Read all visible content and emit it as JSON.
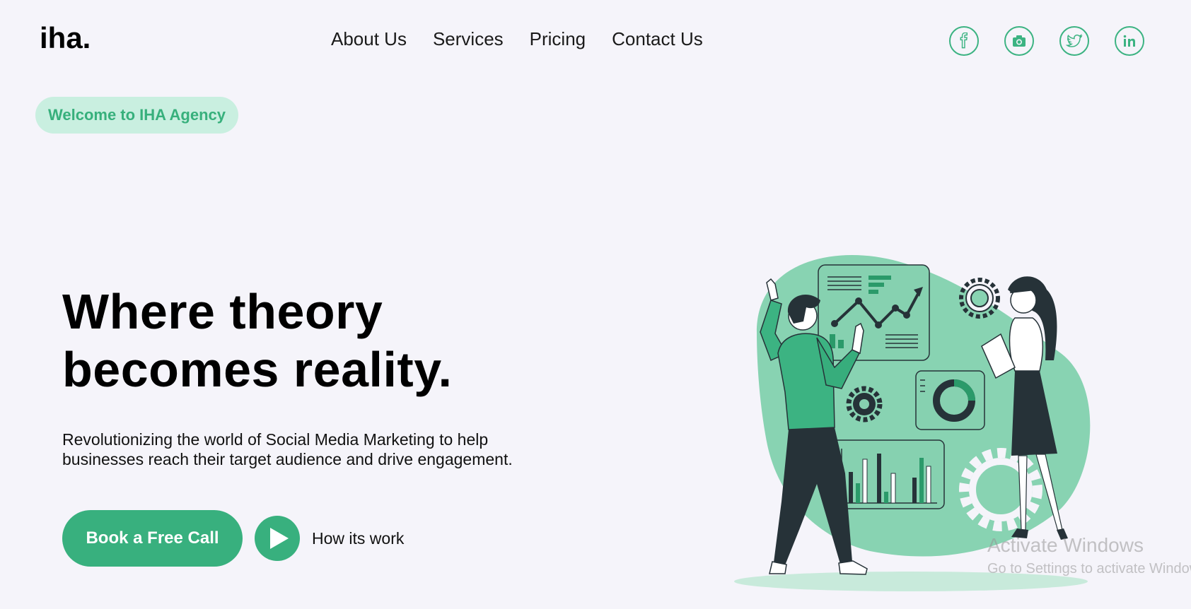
{
  "header": {
    "logo": "iha.",
    "nav": [
      "About Us",
      "Services",
      "Pricing",
      "Contact Us"
    ],
    "social": [
      "facebook-icon",
      "camera-icon",
      "twitter-icon",
      "linkedin-icon"
    ]
  },
  "hero": {
    "badge": "Welcome to IHA Agency",
    "headline_line1": "Where theory",
    "headline_line2": "becomes reality.",
    "sub_line1": "Revolutionizing the world of Social Media Marketing to help",
    "sub_line2": "businesses reach their target audience and drive engagement.",
    "cta": "Book a Free Call",
    "how": "How its work"
  },
  "watermark": {
    "title": "Activate Windows",
    "subtitle": "Go to Settings to activate Windows."
  },
  "colors": {
    "accent": "#38b07e",
    "badge_bg": "#c9efe0",
    "background": "#f5f4fa"
  }
}
